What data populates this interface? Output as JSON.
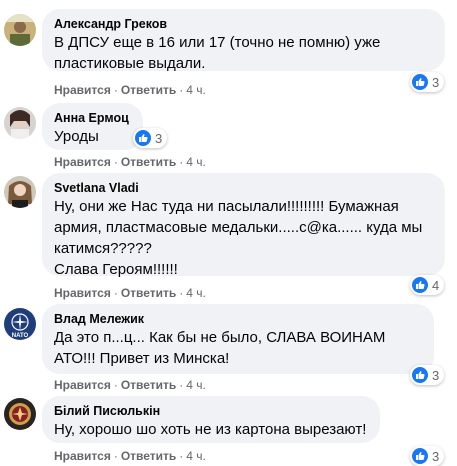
{
  "actions": {
    "like": "Нравится",
    "reply": "Ответить",
    "separator": "·"
  },
  "comments": [
    {
      "author": "Александр Греков",
      "text": "В ДПСУ еще в 16 или 17 (точно не помню) уже пластиковые выдали.",
      "time": "4 ч.",
      "likes": "3"
    },
    {
      "author": "Анна Ермоц",
      "text": "Уроды",
      "time": "4 ч.",
      "likes": "3"
    },
    {
      "author": "Svetlana Vladi",
      "text": "Ну, они же Нас туда ни пасылали!!!!!!!!! Бумажная армия, пластмасовые медальки.....с@ка...... куда мы катимся?????",
      "text2": "Слава Героям!!!!!!",
      "time": "4 ч.",
      "likes": "4"
    },
    {
      "author": "Влад Мележик",
      "text": "Да это п...ц... Как бы не было, СЛАВА ВОИНАМ АТО!!! Привет из Минска!",
      "time": "4 ч.",
      "likes": "3",
      "avatar_text": "NATO"
    },
    {
      "author": "Білий Писюлькін",
      "text": "Ну, хорошо шо хоть не из картона вырезают!",
      "time": "4 ч.",
      "likes": "3"
    }
  ],
  "colors": {
    "bubble": "#f0f2f5",
    "like_blue": "#1877f2",
    "meta_gray": "#65676b"
  }
}
